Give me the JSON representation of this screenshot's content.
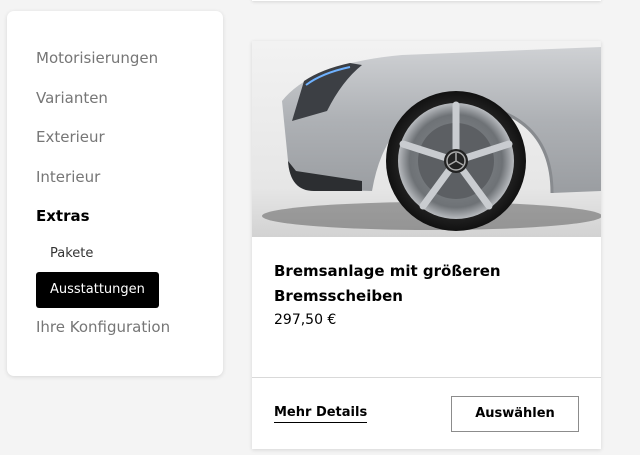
{
  "sidebar": {
    "items": [
      {
        "label": "Motorisierungen"
      },
      {
        "label": "Varianten"
      },
      {
        "label": "Exterieur"
      },
      {
        "label": "Interieur"
      },
      {
        "label": "Extras"
      }
    ],
    "sub_items": [
      {
        "label": "Pakete"
      },
      {
        "label": "Ausstattungen"
      }
    ],
    "summary_label": "Ihre Konfiguration"
  },
  "product_card": {
    "image": "car-wheel-brake-image",
    "title": "Bremsanlage mit größeren Bremsscheiben",
    "price": "297,50 €",
    "details_label": "Mehr Details",
    "select_label": "Auswählen"
  },
  "colors": {
    "accent": "#000000",
    "background": "#f4f4f4",
    "muted_text": "#767676"
  }
}
